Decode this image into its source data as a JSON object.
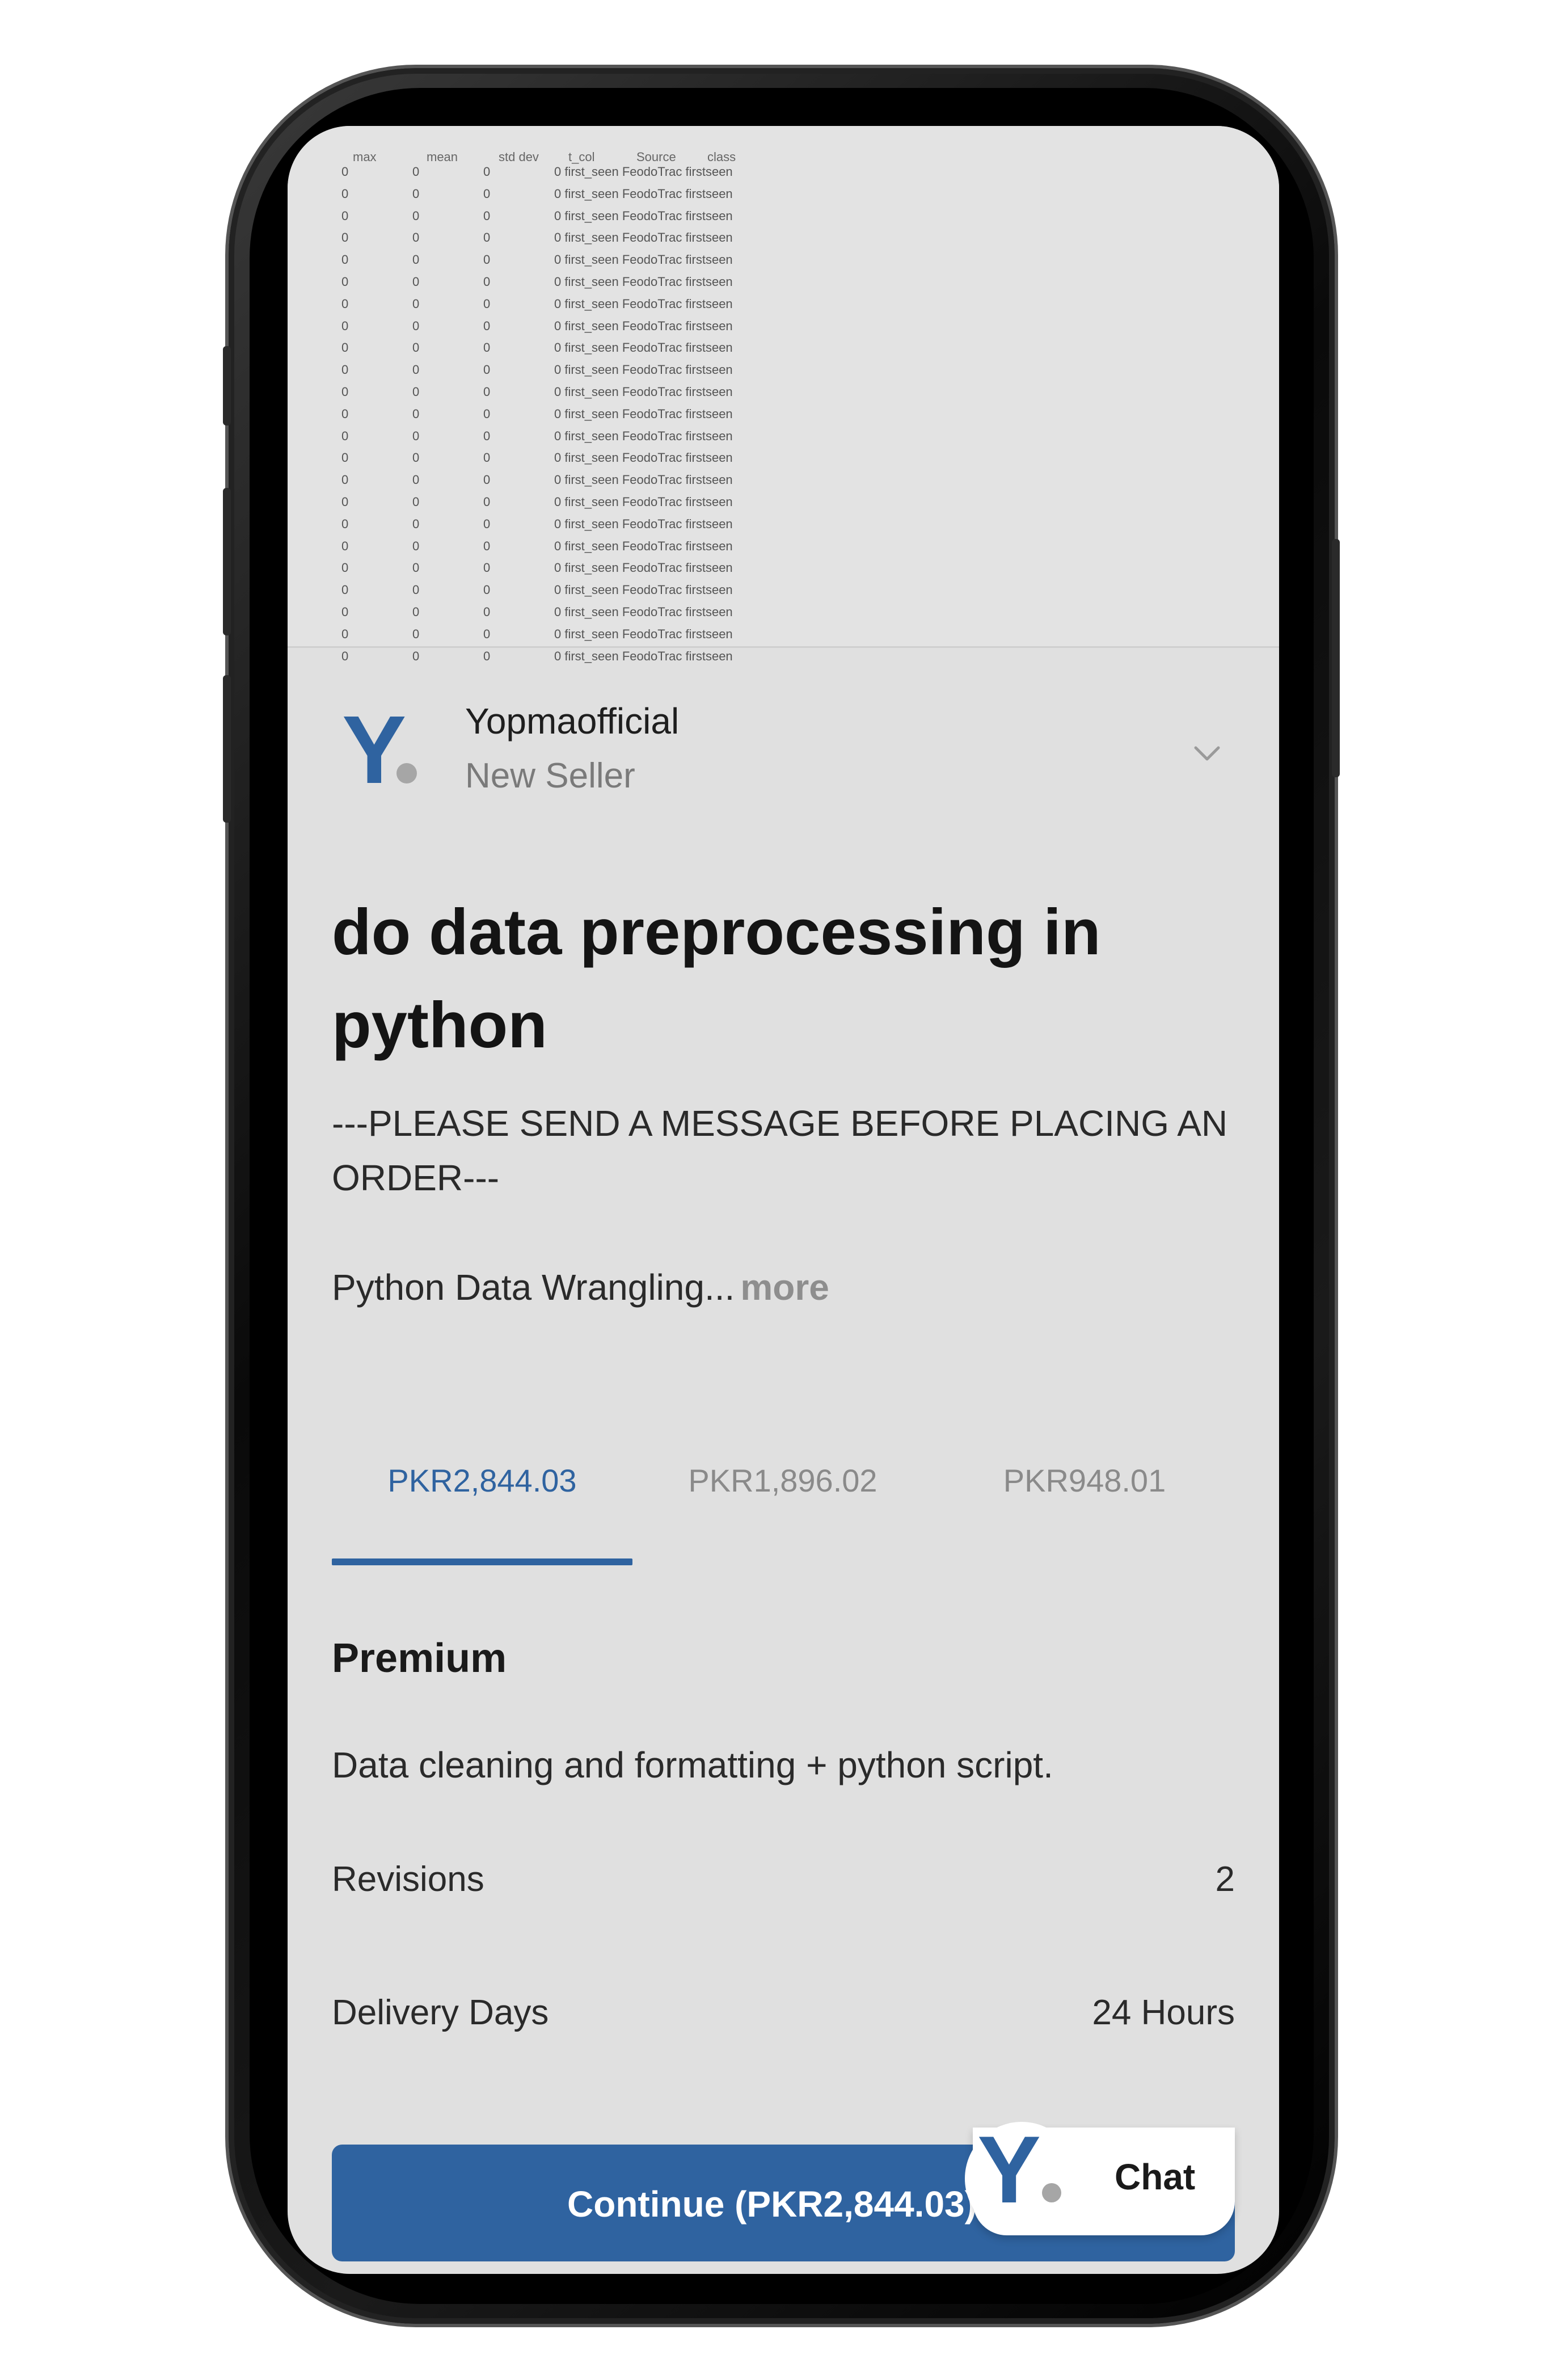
{
  "sheet": {
    "headers": [
      "max",
      "mean",
      "std dev",
      "t_col",
      "Source",
      "class"
    ],
    "row_values": [
      "0",
      "0",
      "0",
      "0 first_seen FeodoTrac firstseen"
    ],
    "row_count": 23
  },
  "seller": {
    "name": "Yopmaofficial",
    "level": "New Seller",
    "logo_letter": "Y",
    "expand_icon": "chevron-down-icon"
  },
  "gig": {
    "title": "do data preprocessing in python",
    "notice": "---PLEASE SEND A MESSAGE BEFORE PLACING AN ORDER---",
    "description": "Python Data Wrangling...",
    "more_label": "more"
  },
  "pricing": {
    "tabs": [
      {
        "label": "PKR2,844.03",
        "active": true
      },
      {
        "label": "PKR1,896.02",
        "active": false
      },
      {
        "label": "PKR948.01",
        "active": false
      }
    ],
    "package_name": "Premium",
    "package_description": "Data cleaning and formatting + python script.",
    "revisions_label": "Revisions",
    "revisions_value": "2",
    "delivery_label": "Delivery Days",
    "delivery_value": "24 Hours",
    "continue_label": "Continue (PKR2,844.03)"
  },
  "chat": {
    "label": "Chat",
    "logo_letter": "Y"
  },
  "colors": {
    "accent": "#2f63a0",
    "screen_bg": "#e0e0e0",
    "muted_text": "#8a8a8a"
  }
}
